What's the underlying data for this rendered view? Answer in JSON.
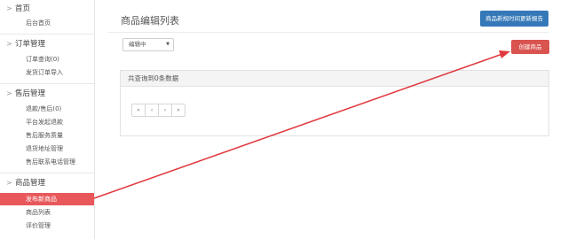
{
  "sidebar": {
    "sections": [
      {
        "label": "首页",
        "items": [
          {
            "label": "后台首页"
          }
        ]
      },
      {
        "label": "订单管理",
        "items": [
          {
            "label": "订单查询(0)"
          },
          {
            "label": "发货订单导入"
          }
        ]
      },
      {
        "label": "售后管理",
        "items": [
          {
            "label": "退款/售后(0)"
          },
          {
            "label": "平台发起退款"
          },
          {
            "label": "售后服务质量"
          },
          {
            "label": "退货地址管理"
          },
          {
            "label": "售后联系电话管理"
          }
        ]
      },
      {
        "label": "商品管理",
        "items": [
          {
            "label": "发布新商品",
            "active": true
          },
          {
            "label": "商品列表"
          },
          {
            "label": "评价管理"
          }
        ]
      }
    ]
  },
  "header": {
    "title": "商品编辑列表",
    "report_button": "商品新规时间更新报告"
  },
  "filter": {
    "status_select": "编辑中"
  },
  "toolbar": {
    "create_button": "创建商品"
  },
  "results": {
    "summary": "共查询到0条数据",
    "pager": [
      "«",
      "‹",
      "›",
      "»"
    ]
  },
  "colors": {
    "primary": "#3578b8",
    "danger": "#d9534f",
    "active_nav": "#e8585b",
    "annotation_arrow": "#e0393e"
  },
  "icons": {
    "section_chevron": "chevron-right-icon",
    "select_caret": "caret-down-icon"
  }
}
